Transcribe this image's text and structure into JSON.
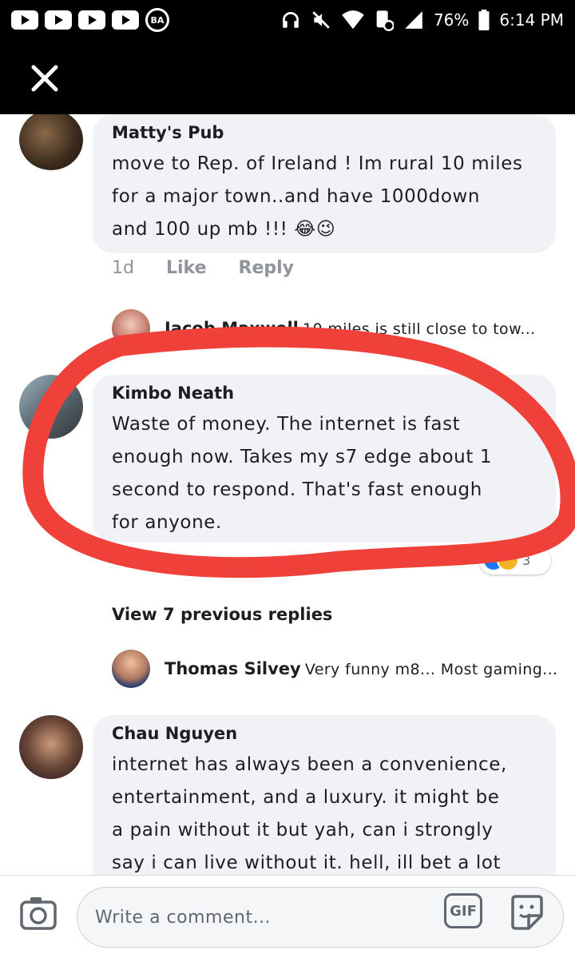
{
  "status_bar": {
    "battery": "76%",
    "time": "6:14 PM",
    "badge": "BA"
  },
  "comments": [
    {
      "author": "Matty's Pub",
      "lines": [
        "move to Rep. of Ireland ! Im rural 10 miles",
        "for a major town..and have 1000down",
        "and 100 up mb !!! 😂😉"
      ],
      "time": "1d",
      "like": "Like",
      "reply": "Reply"
    },
    {
      "author": "Kimbo Neath",
      "lines": [
        "Waste of money. The internet is fast",
        "enough now. Takes my s7 edge about 1",
        "second to respond. That's fast enough",
        "for anyone."
      ],
      "reaction_count": "3"
    },
    {
      "author": "Chau Nguyen",
      "lines": [
        "internet has always been a convenience,",
        "entertainment, and a luxury. it might be",
        "a pain without it but yah, can i strongly",
        "say i can live without it. hell, ill bet a lot"
      ]
    }
  ],
  "replies": [
    {
      "author": "Jacob Maxwell",
      "preview": "10 miles is still close to tow..."
    },
    {
      "author": "Thomas Silvey",
      "preview": "Very funny m8... Most gaming..."
    }
  ],
  "view_previous": "View 7 previous replies",
  "composer": {
    "placeholder": "Write a comment...",
    "gif_label": "GIF"
  },
  "colors": {
    "highlight_stroke": "#f0403a",
    "bubble": "#f0f2f5",
    "like_blue": "#1877f2",
    "haha_yellow": "#f7b125"
  },
  "icons": [
    "youtube-icon",
    "ba-icon",
    "headphones-icon",
    "mute-icon",
    "wifi-icon",
    "data-saver-icon",
    "signal-icon",
    "battery-icon",
    "close-icon",
    "camera-icon",
    "gif-icon",
    "sticker-icon"
  ]
}
